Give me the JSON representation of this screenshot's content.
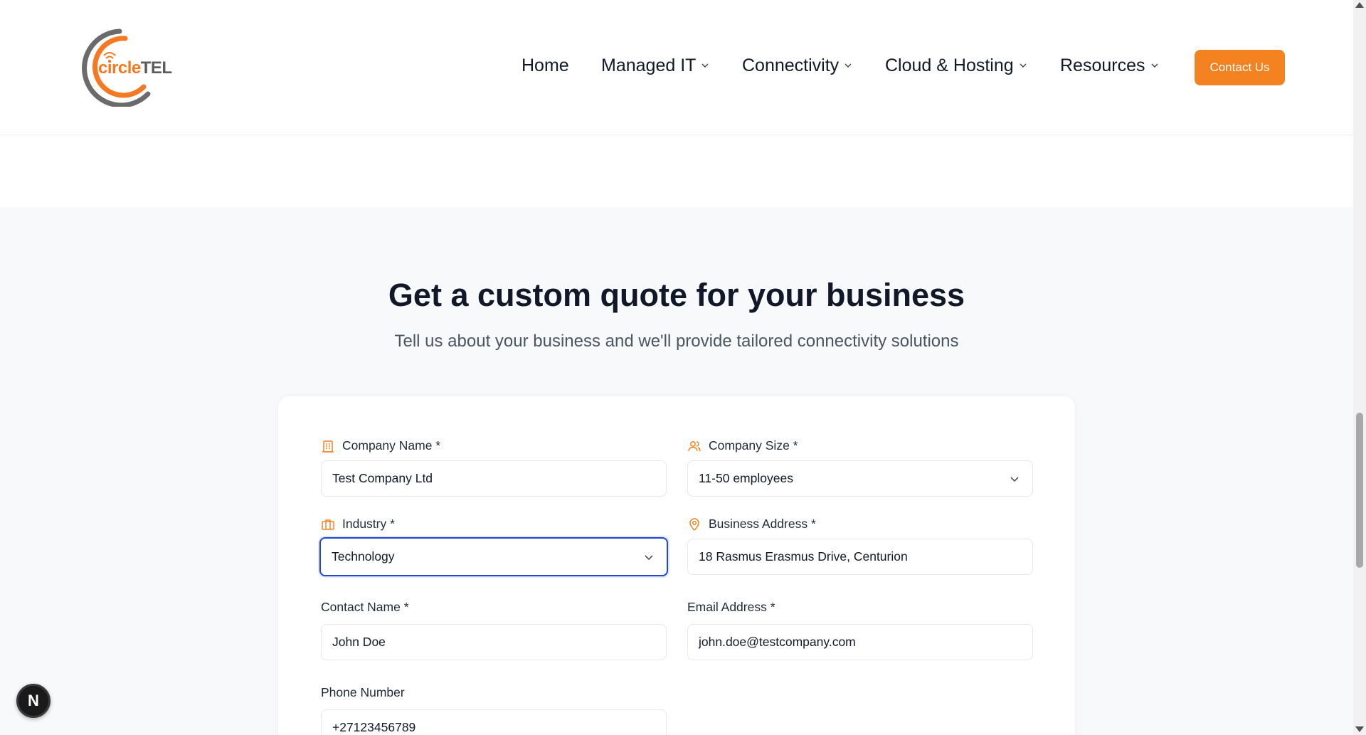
{
  "brand": {
    "logo_prefix": "circle",
    "logo_suffix": "TEL",
    "accent_color": "#f58220",
    "focus_color": "#2149c9"
  },
  "nav": {
    "items": [
      {
        "label": "Home",
        "has_dropdown": false
      },
      {
        "label": "Managed IT",
        "has_dropdown": true
      },
      {
        "label": "Connectivity",
        "has_dropdown": true
      },
      {
        "label": "Cloud & Hosting",
        "has_dropdown": true
      },
      {
        "label": "Resources",
        "has_dropdown": true
      }
    ],
    "contact_label": "Contact Us"
  },
  "hero": {
    "title": "Get a custom quote for your business",
    "subtitle": "Tell us about your business and we'll provide tailored connectivity solutions"
  },
  "form": {
    "company_name": {
      "label": "Company Name *",
      "value": "Test Company Ltd",
      "icon": "building-icon"
    },
    "company_size": {
      "label": "Company Size *",
      "value": "11-50 employees",
      "icon": "users-icon"
    },
    "industry": {
      "label": "Industry *",
      "value": "Technology",
      "icon": "briefcase-icon"
    },
    "business_address": {
      "label": "Business Address *",
      "value": "18 Rasmus Erasmus Drive, Centurion",
      "icon": "map-pin-icon"
    },
    "contact_name": {
      "label": "Contact Name *",
      "value": "John Doe"
    },
    "email": {
      "label": "Email Address *",
      "value": "john.doe@testcompany.com"
    },
    "phone": {
      "label": "Phone Number",
      "value": "+27123456789"
    }
  },
  "dev_badge": {
    "letter": "N"
  }
}
